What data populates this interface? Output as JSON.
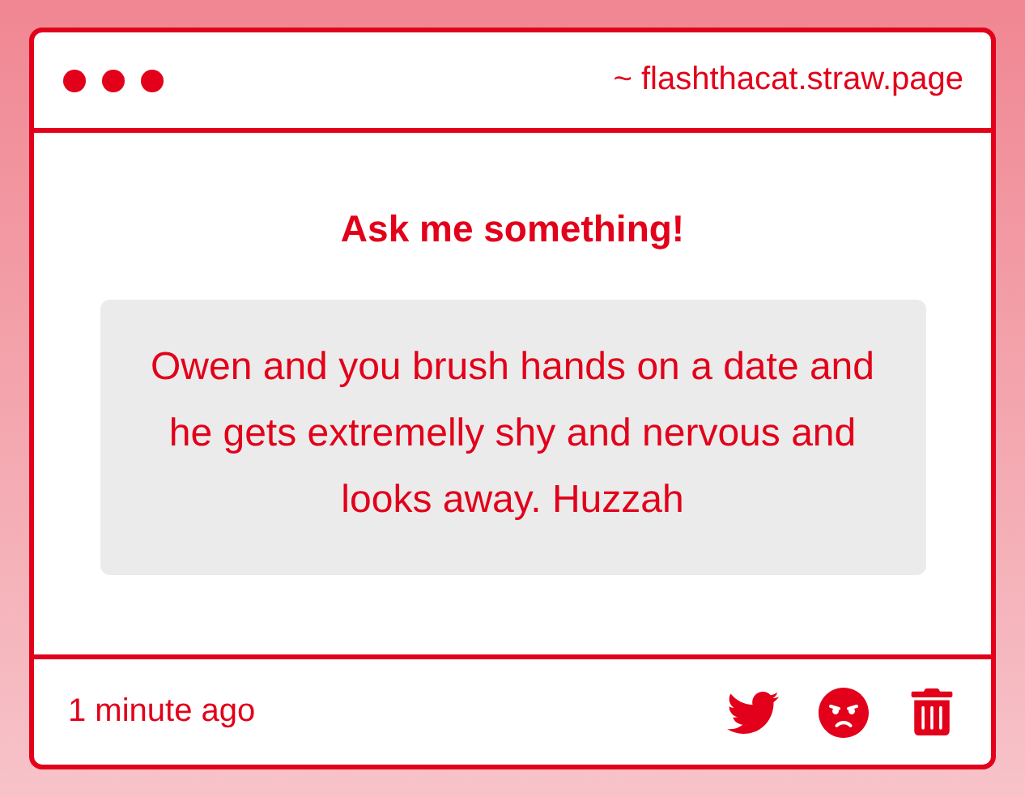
{
  "window": {
    "url": "~ flashthacat.straw.page"
  },
  "card": {
    "title": "Ask me something!",
    "question": "Owen and you brush hands on a date and he gets extremelly shy and nervous and looks away. Huzzah"
  },
  "footer": {
    "time": "1 minute ago"
  }
}
